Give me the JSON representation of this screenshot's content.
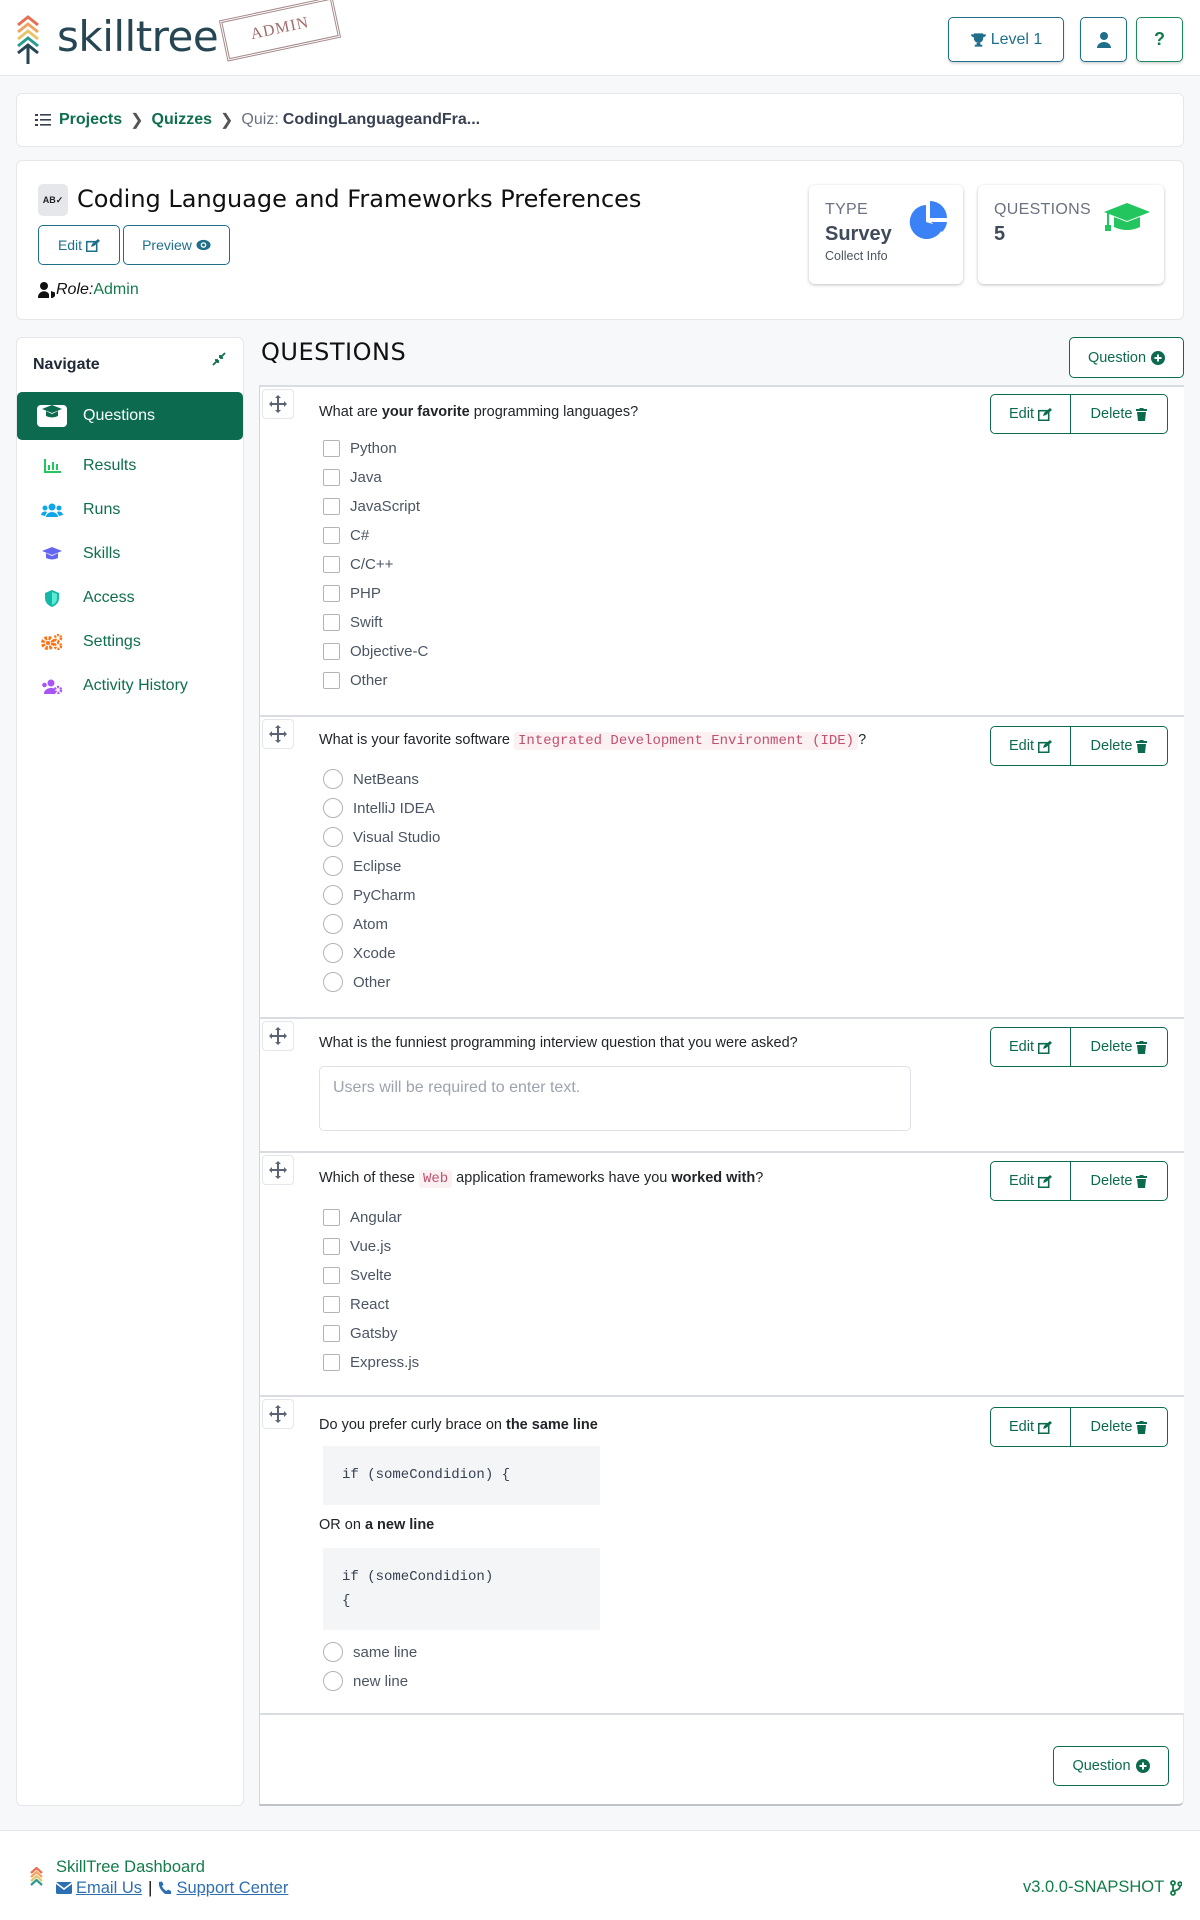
{
  "header": {
    "logo_text": "skilltree",
    "stamp": "ADMIN",
    "level_label": "Level 1",
    "icons": {
      "level": "trophy-icon",
      "user": "user-icon",
      "help": "question-icon"
    }
  },
  "breadcrumb": {
    "items": [
      "Projects",
      "Quizzes"
    ],
    "current_prefix": "Quiz:",
    "current": "CodingLanguageandFra..."
  },
  "quiz": {
    "title": "Coding Language and Frameworks Preferences",
    "edit_label": "Edit",
    "preview_label": "Preview",
    "role_label": "Role:",
    "role_value": "Admin",
    "stats": [
      {
        "label": "TYPE",
        "value": "Survey",
        "sub": "Collect Info",
        "icon": "pie-chart-icon",
        "color": "#3b82f6"
      },
      {
        "label": "QUESTIONS",
        "value": "5",
        "sub": "",
        "icon": "graduation-cap-icon",
        "color": "#22c55e"
      }
    ]
  },
  "sidebar": {
    "title": "Navigate",
    "items": [
      {
        "label": "Questions",
        "icon": "graduation-cap-icon",
        "active": true
      },
      {
        "label": "Results",
        "icon": "bar-chart-icon",
        "color": "#22c55e"
      },
      {
        "label": "Runs",
        "icon": "users-icon",
        "color": "#0ea5e9"
      },
      {
        "label": "Skills",
        "icon": "graduation-cap-icon",
        "color": "#6366f1"
      },
      {
        "label": "Access",
        "icon": "shield-icon",
        "color": "#14b8a6"
      },
      {
        "label": "Settings",
        "icon": "gears-icon",
        "color": "#f97316"
      },
      {
        "label": "Activity History",
        "icon": "users-cog-icon",
        "color": "#a855f7"
      }
    ]
  },
  "main": {
    "heading": "QUESTIONS",
    "add_question_label": "Question",
    "edit_label": "Edit",
    "delete_label": "Delete",
    "questions": [
      {
        "text_parts": [
          [
            "What are ",
            "n"
          ],
          [
            "your favorite",
            "b"
          ],
          [
            " programming languages?",
            "n"
          ]
        ],
        "type": "checkbox",
        "options": [
          "Python",
          "Java",
          "JavaScript",
          "C#",
          "C/C++",
          "PHP",
          "Swift",
          "Objective-C",
          "Other"
        ]
      },
      {
        "text_parts": [
          [
            "What is your favorite software ",
            "n"
          ],
          [
            "Integrated Development Environment (IDE)",
            "c"
          ],
          [
            "?",
            "n"
          ]
        ],
        "type": "radio",
        "options": [
          "NetBeans",
          "IntelliJ IDEA",
          "Visual Studio",
          "Eclipse",
          "PyCharm",
          "Atom",
          "Xcode",
          "Other"
        ]
      },
      {
        "text_parts": [
          [
            "What is the funniest programming interview question that you were asked?",
            "n"
          ]
        ],
        "type": "text",
        "placeholder": "Users will be required to enter text."
      },
      {
        "text_parts": [
          [
            "Which of these ",
            "n"
          ],
          [
            "Web",
            "c"
          ],
          [
            " application frameworks have you ",
            "n"
          ],
          [
            "worked with",
            "b"
          ],
          [
            "?",
            "n"
          ]
        ],
        "type": "checkbox",
        "options": [
          "Angular",
          "Vue.js",
          "Svelte",
          "React",
          "Gatsby",
          "Express.js"
        ]
      },
      {
        "text_parts": [
          [
            "Do you prefer curly brace on ",
            "n"
          ],
          [
            "the same line",
            "b"
          ]
        ],
        "code1": "if (someCondidion) {",
        "middle_parts": [
          [
            "OR on ",
            "n"
          ],
          [
            "a new line",
            "b"
          ]
        ],
        "code2": "if (someCondidion)\n{",
        "type": "radio",
        "options": [
          "same line",
          "new line"
        ]
      }
    ]
  },
  "footer": {
    "title": "SkillTree Dashboard",
    "email_label": "Email Us",
    "support_label": "Support Center",
    "version": "v3.0.0-SNAPSHOT"
  }
}
